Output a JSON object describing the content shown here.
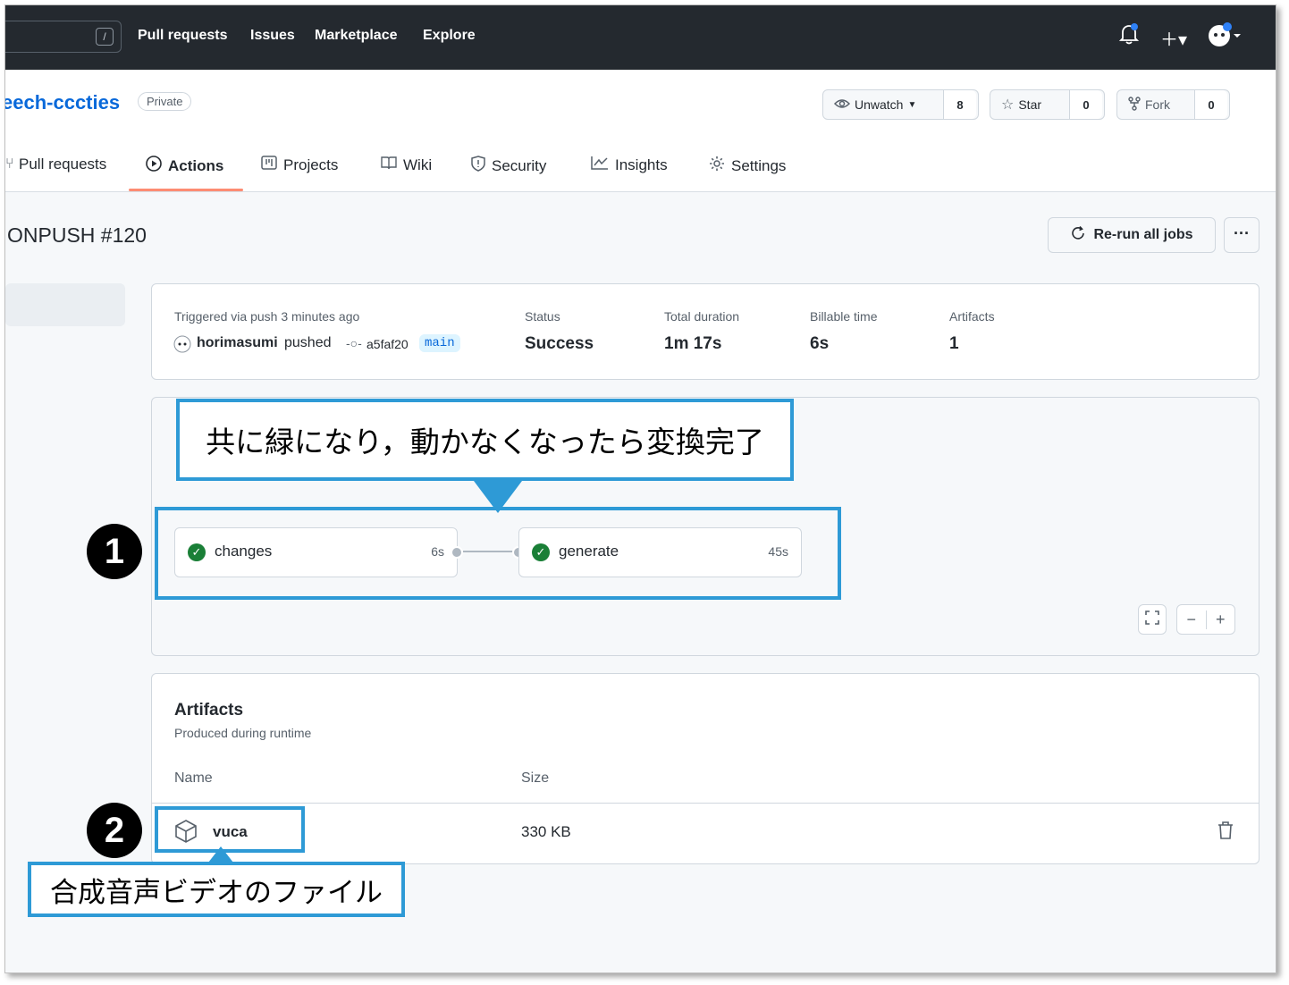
{
  "topbar": {
    "search_shortcut": "/",
    "nav": [
      "Pull requests",
      "Issues",
      "Marketplace",
      "Explore"
    ]
  },
  "repo": {
    "name": "eech-cccties",
    "visibility": "Private",
    "unwatch_label": "Unwatch",
    "watch_count": "8",
    "star_label": "Star",
    "star_count": "0",
    "fork_label": "Fork",
    "fork_count": "0"
  },
  "tabs": [
    {
      "label": "Pull requests",
      "icon": "pull-request-icon"
    },
    {
      "label": "Actions",
      "icon": "play-icon",
      "active": true
    },
    {
      "label": "Projects",
      "icon": "project-icon"
    },
    {
      "label": "Wiki",
      "icon": "book-icon"
    },
    {
      "label": "Security",
      "icon": "shield-icon"
    },
    {
      "label": "Insights",
      "icon": "graph-icon"
    },
    {
      "label": "Settings",
      "icon": "gear-icon"
    }
  ],
  "run": {
    "title": "ONPUSH #120",
    "rerun_label": "Re-run all jobs",
    "more_label": "···"
  },
  "summary": {
    "trigger_label": "Triggered via push 3 minutes ago",
    "user": "horimasumi",
    "action": "pushed",
    "commit": "a5faf20",
    "branch": "main",
    "status_label": "Status",
    "status_value": "Success",
    "duration_label": "Total duration",
    "duration_value": "1m 17s",
    "billable_label": "Billable time",
    "billable_value": "6s",
    "artifacts_label": "Artifacts",
    "artifacts_value": "1"
  },
  "jobs": [
    {
      "name": "changes",
      "time": "6s",
      "status": "success"
    },
    {
      "name": "generate",
      "time": "45s",
      "status": "success"
    }
  ],
  "graph_controls": {
    "fullscreen": "⛶",
    "zoom_out": "−",
    "zoom_in": "+"
  },
  "artifacts": {
    "title": "Artifacts",
    "subtitle": "Produced during runtime",
    "col_name": "Name",
    "col_size": "Size",
    "rows": [
      {
        "name": "vuca",
        "size": "330 KB"
      }
    ]
  },
  "annotations": {
    "callout1": "共に緑になり，動かなくなったら変換完了",
    "callout2": "合成音声ビデオのファイル",
    "marker1": "1",
    "marker2": "2"
  },
  "colors": {
    "header_bg": "#24292f",
    "link": "#0969da",
    "success": "#1a7f37",
    "annotation_border": "#2e9ad6",
    "tab_underline": "#fd8c73"
  }
}
